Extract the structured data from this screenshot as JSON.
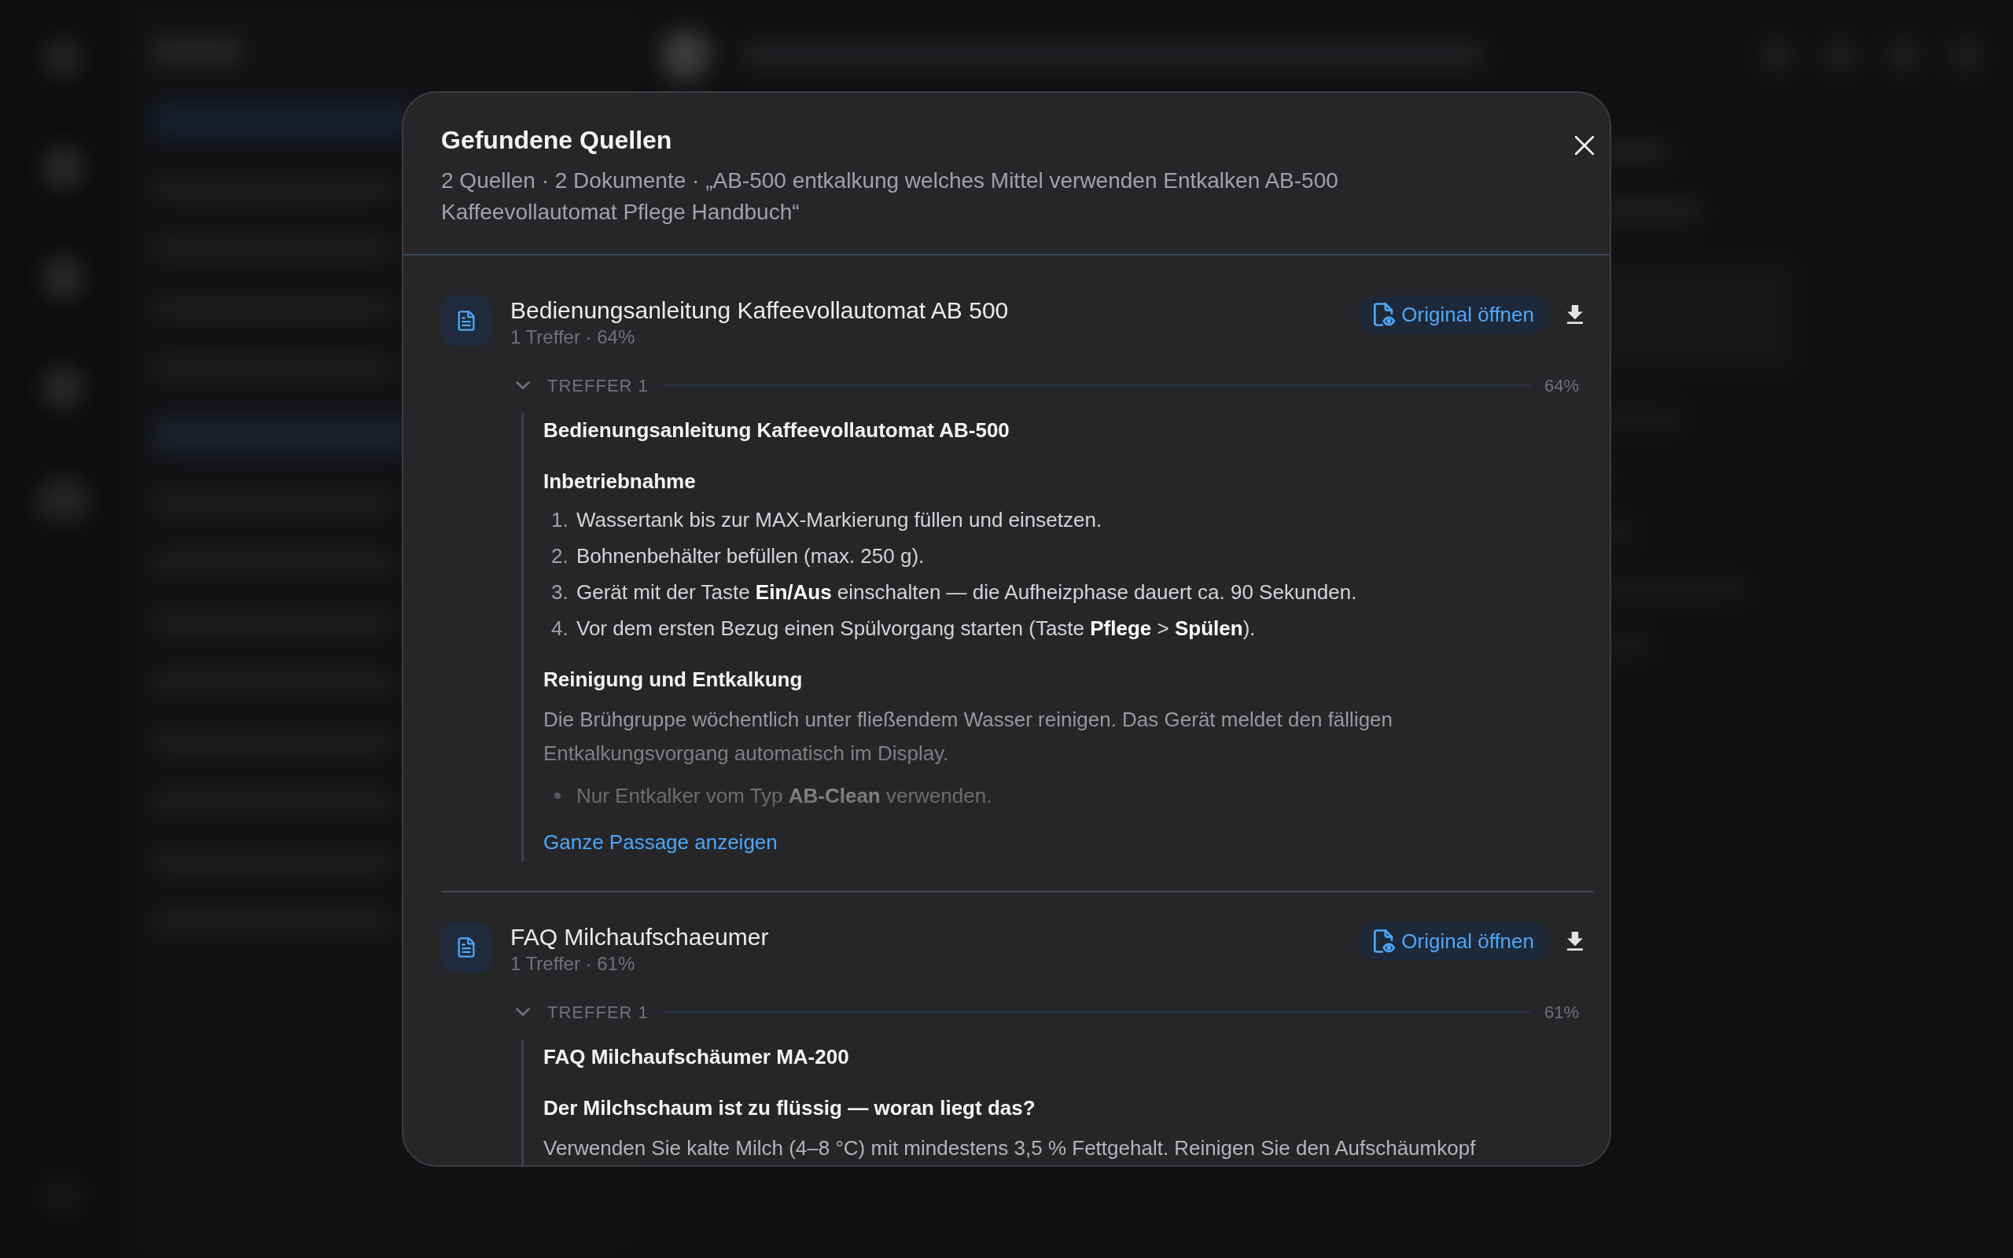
{
  "dialog": {
    "title": "Gefundene Quellen",
    "summary": "2 Quellen · 2 Dokumente · „AB-500 entkalkung welches Mittel verwenden Entkalken AB-500 Kaffeevollautomat Pflege Handbuch“",
    "documents": [
      {
        "title": "Bedienungsanleitung Kaffeevollautomat AB 500",
        "meta": "1 Treffer · 64%",
        "open_button": "Original öffnen",
        "hits": [
          {
            "label": "TREFFER 1",
            "score": "64%",
            "expanded": true,
            "truncated": true,
            "blocks": [
              {
                "kind": "heading",
                "text": "Bedienungsanleitung Kaffeevollautomat AB-500"
              },
              {
                "kind": "subheading",
                "text": "Inbetriebnahme"
              },
              {
                "kind": "ordered_list",
                "items": [
                  {
                    "marker": "1.",
                    "text": "Wassertank bis zur MAX-Markierung füllen und einsetzen."
                  },
                  {
                    "marker": "2.",
                    "text": "Bohnenbehälter befüllen (max. 250 g)."
                  },
                  {
                    "marker": "3.",
                    "text": "Gerät mit der Taste **Ein/Aus** einschalten — die Aufheizphase dauert ca. 90 Sekunden."
                  },
                  {
                    "marker": "4.",
                    "text": "Vor dem ersten Bezug einen Spülvorgang starten (Taste **Pflege** > **Spülen**)."
                  }
                ]
              },
              {
                "kind": "subheading",
                "text": "Reinigung und Entkalkung"
              },
              {
                "kind": "paragraph",
                "text": "Die Brühgruppe wöchentlich unter fließendem Wasser reinigen. Das Gerät meldet den fälligen Entkalkungsvorgang automatisch im Display."
              },
              {
                "kind": "bullet_list",
                "items": [
                  "Nur Entkalker vom Typ **AB-Clean** verwenden."
                ]
              }
            ],
            "more_link": "Ganze Passage anzeigen"
          }
        ]
      },
      {
        "title": "FAQ Milchaufschaeumer",
        "meta": "1 Treffer · 61%",
        "open_button": "Original öffnen",
        "hits": [
          {
            "label": "TREFFER 1",
            "score": "61%",
            "expanded": true,
            "truncated": false,
            "blocks": [
              {
                "kind": "heading",
                "text": "FAQ Milchaufschäumer MA-200"
              },
              {
                "kind": "subheading",
                "text": "Der Milchschaum ist zu flüssig — woran liegt das?"
              },
              {
                "kind": "paragraph",
                "text": "Verwenden Sie kalte Milch (4–8 °C) mit mindestens 3,5 % Fettgehalt. Reinigen Sie den Aufschäumkopf"
              }
            ]
          }
        ]
      }
    ]
  }
}
